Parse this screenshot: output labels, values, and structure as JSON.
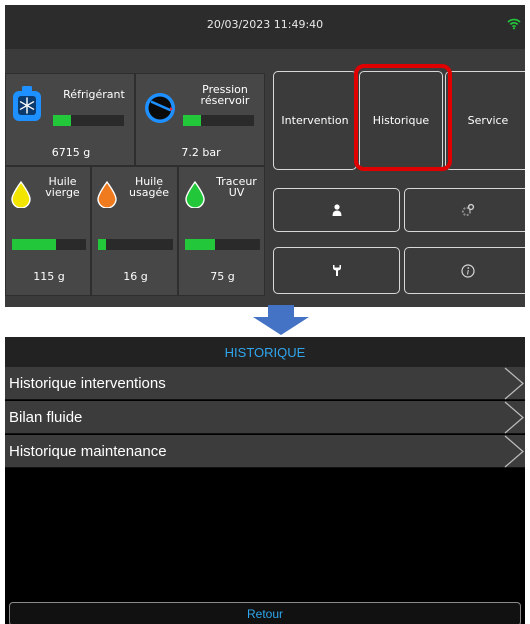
{
  "status_bar": {
    "datetime": "20/03/2023 11:49:40",
    "wifi_icon": "wifi-icon"
  },
  "gauges": {
    "refrigerant": {
      "label": "Réfrigérant",
      "value": "6715 g",
      "level": 0.25,
      "icon": "refrigerant-bottle-icon",
      "color": "#1e90ff"
    },
    "tank_pressure": {
      "label": "Pression\nréservoir",
      "value": "7.2 bar",
      "level": 0.25,
      "icon": "pressure-gauge-icon",
      "color": "#1e90ff"
    },
    "virgin_oil": {
      "label": "Huile\nvierge",
      "value": "115 g",
      "level": 0.6,
      "icon": "oil-drop-yellow-icon",
      "color": "#f2e600"
    },
    "used_oil": {
      "label": "Huile\nusagée",
      "value": "16 g",
      "level": 0.1,
      "icon": "oil-drop-orange-icon",
      "color": "#f07a1e"
    },
    "uv_tracer": {
      "label": "Traceur\nUV",
      "value": "75 g",
      "level": 0.4,
      "icon": "oil-drop-green-icon",
      "color": "#22c83a"
    }
  },
  "buttons": {
    "intervention": "Intervention",
    "historique": "Historique",
    "service": "Service",
    "user": "user-icon",
    "settings": "settings-icon",
    "tools": "wrench-icon",
    "info": "info-icon"
  },
  "highlight_color": "#e00000",
  "arrow_color": "#4472c4",
  "historique_screen": {
    "title": "HISTORIQUE",
    "items": [
      {
        "label": "Historique interventions"
      },
      {
        "label": "Bilan fluide"
      },
      {
        "label": "Historique maintenance"
      }
    ],
    "back_label": "Retour"
  }
}
